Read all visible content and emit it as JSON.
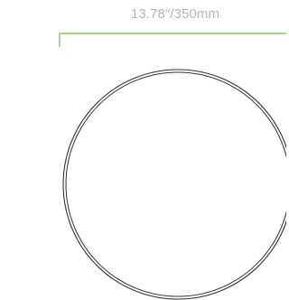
{
  "dimension": {
    "label": "13.78″/350mm",
    "color": "#6abf45"
  },
  "plate": {
    "shape": "circle",
    "outline_color": "#333333"
  }
}
